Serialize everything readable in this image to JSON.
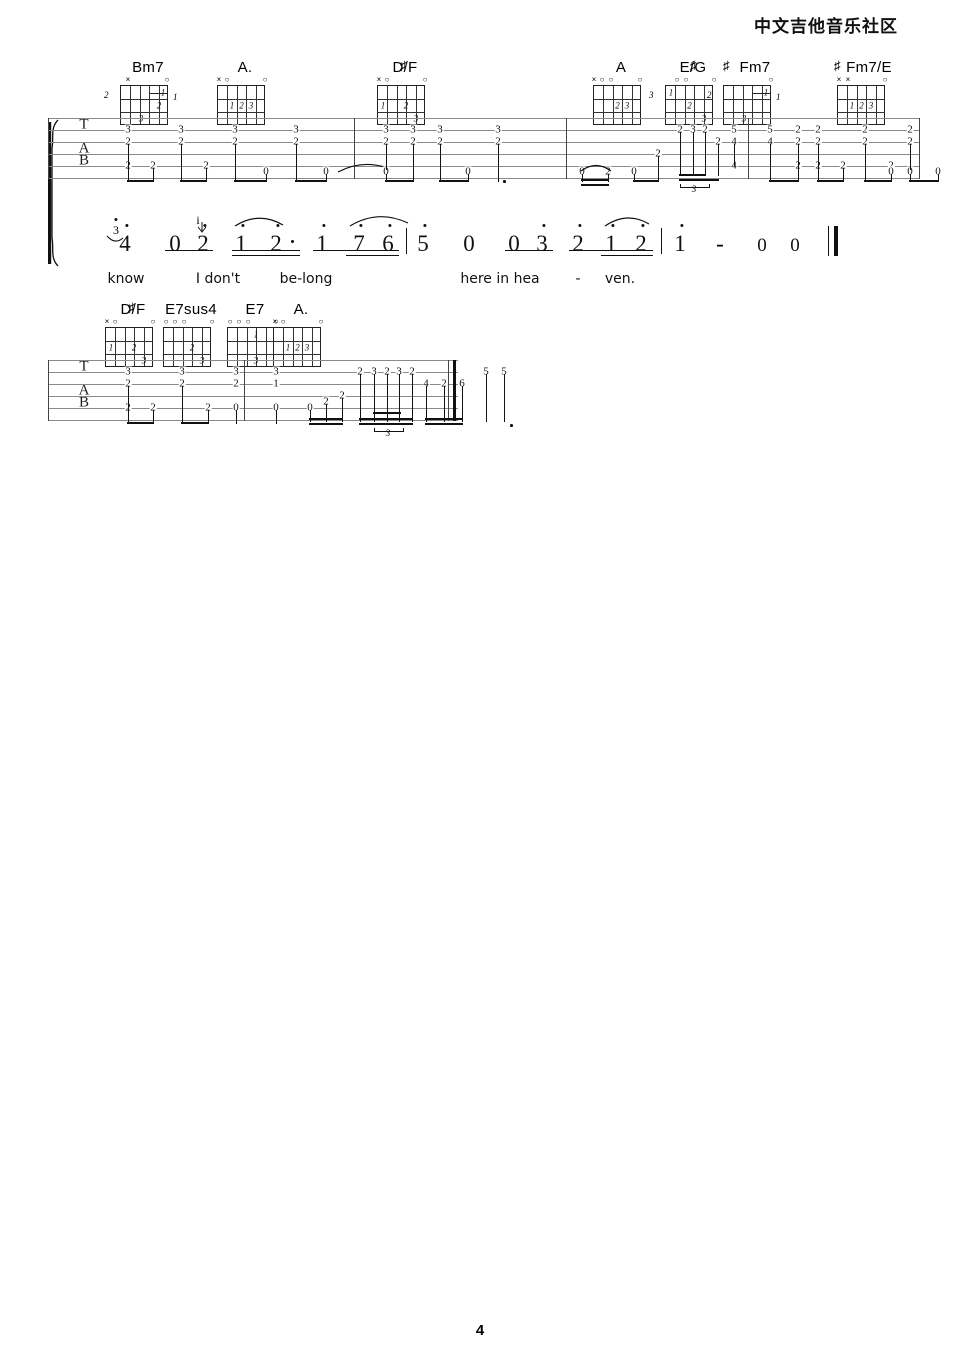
{
  "header": {
    "site_title": "中文吉他音乐社区"
  },
  "footer": {
    "page_number": "4"
  },
  "systems": [
    {
      "id": "system-1",
      "chords": [
        {
          "name": "Bm7",
          "root": "Bm7",
          "sharp": false,
          "base_fret": "2",
          "right_num": "1",
          "markers": "x o",
          "fingers": [
            "1",
            "2",
            "3"
          ]
        },
        {
          "name": "A.",
          "root": "A.",
          "sharp": false,
          "base_fret": "",
          "right_num": "",
          "markers": "xo  o",
          "fingers": [
            "1",
            "2",
            "3"
          ]
        },
        {
          "name": "D/#F",
          "root": "D/F",
          "sharp": true,
          "base_fret": "",
          "right_num": "",
          "markers": "xo  o",
          "fingers": [
            "1",
            "2",
            "3"
          ]
        },
        {
          "name": "A",
          "root": "A",
          "sharp": false,
          "base_fret": "",
          "right_num": "",
          "markers": "xoo o",
          "fingers": [
            "2",
            "3"
          ]
        },
        {
          "name": "E/#G",
          "root": "E/G",
          "sharp": true,
          "base_fret": "3",
          "right_num": "",
          "markers": "oo o",
          "fingers": [
            "1",
            "2",
            "3"
          ]
        },
        {
          "name": "#Fm7",
          "root": "Fm7",
          "sharp": true,
          "base_fret": "2",
          "right_num": "1",
          "markers": "o",
          "fingers": [
            "1",
            "3"
          ]
        },
        {
          "name": "#Fm7/E",
          "root": "Fm7/E",
          "sharp": true,
          "base_fret": "",
          "right_num": "",
          "markers": "xx o",
          "fingers": [
            "1",
            "2",
            "3"
          ]
        }
      ],
      "tab": {
        "string_labels": [
          "T",
          "A",
          "B"
        ],
        "measures": [
          {
            "notes": [
              "3",
              "2",
              "2",
              "2",
              "2",
              "3",
              "2",
              "2",
              "0"
            ]
          },
          {
            "notes": [
              "3",
              "2",
              "0",
              "3",
              "2",
              "0",
              "3",
              "2",
              "3",
              "2",
              "0",
              "2"
            ]
          },
          {
            "notes": [
              "0",
              "2",
              "3",
              "2",
              "2",
              "5",
              "4",
              "4",
              "5",
              "4",
              "2",
              "2",
              "2"
            ]
          },
          {
            "notes": [
              "2",
              "2",
              "2",
              "2",
              "2",
              "2",
              "2",
              "2",
              "0",
              "0",
              "2",
              "0"
            ]
          }
        ],
        "triplet_label": "3"
      },
      "melody": {
        "notes": [
          "4",
          "0",
          "2",
          "1",
          "2",
          "1",
          "7",
          "6",
          "5",
          "0",
          "0",
          "3",
          "2",
          "1",
          "2",
          "1"
        ],
        "grace_note": "3",
        "dashes": [
          "-"
        ],
        "rests": [
          "0",
          "0"
        ],
        "lyrics": [
          "know",
          "I don't",
          "be-long",
          "here in hea",
          "-",
          "ven."
        ]
      }
    },
    {
      "id": "system-2",
      "chords": [
        {
          "name": "D/#F",
          "root": "D/F",
          "sharp": true,
          "base_fret": "",
          "right_num": "",
          "markers": "xo  o",
          "fingers": [
            "1",
            "2",
            "3"
          ]
        },
        {
          "name": "E7sus4",
          "root": "E7sus4",
          "sharp": false,
          "base_fret": "",
          "right_num": "",
          "markers": "ooo  o",
          "fingers": [
            "2",
            "3"
          ]
        },
        {
          "name": "E7",
          "root": "E7",
          "sharp": false,
          "base_fret": "",
          "right_num": "",
          "markers": "ooo  o",
          "fingers": [
            "1",
            "3"
          ]
        },
        {
          "name": "A.",
          "root": "A.",
          "sharp": false,
          "base_fret": "",
          "right_num": "",
          "markers": "xo   o",
          "fingers": [
            "1",
            "2",
            "3"
          ]
        }
      ],
      "tab": {
        "string_labels": [
          "T",
          "A",
          "B"
        ],
        "measures": [
          {
            "notes": [
              "3",
              "2",
              "2",
              "2",
              "2",
              "3",
              "2",
              "3",
              "2",
              "0",
              "3",
              "1",
              "0"
            ]
          },
          {
            "notes": [
              "0",
              "2",
              "2",
              "2",
              "3",
              "2",
              "3",
              "2",
              "4",
              "2",
              "6",
              "5",
              "5"
            ]
          }
        ],
        "triplet_label": "3"
      }
    }
  ]
}
